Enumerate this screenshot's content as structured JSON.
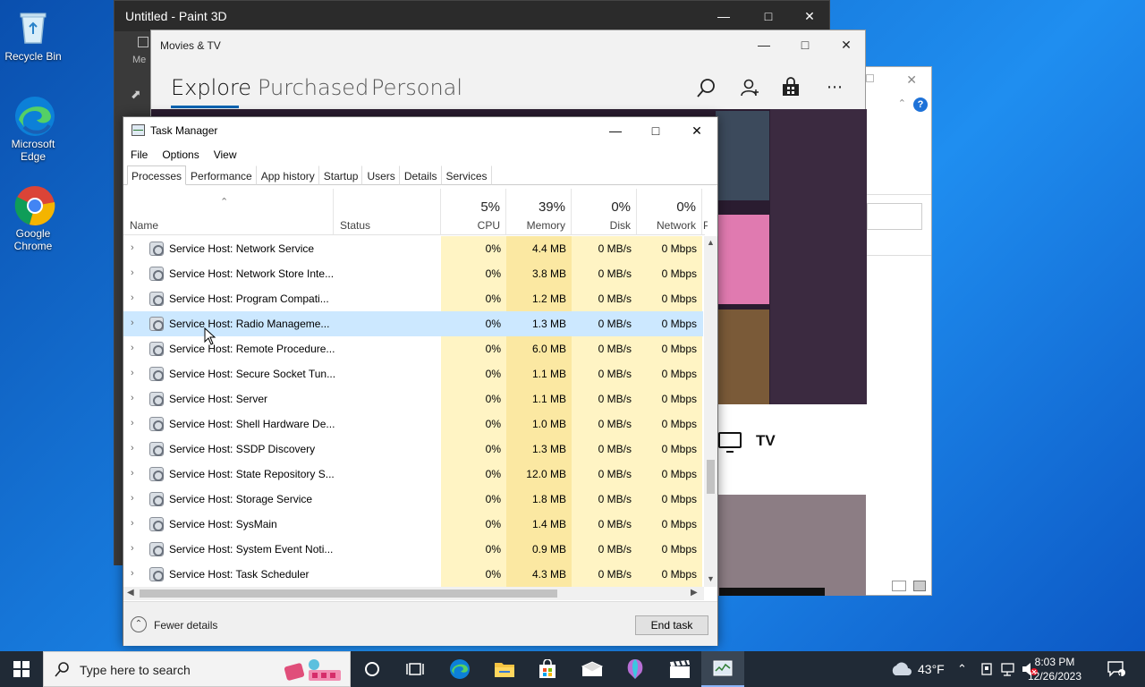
{
  "desktop": {
    "icons": [
      {
        "label": "Recycle Bin"
      },
      {
        "label": "Microsoft Edge"
      },
      {
        "label": "Google Chrome"
      }
    ]
  },
  "paint3d": {
    "title": "Untitled - Paint 3D",
    "menu_fragment": "Me"
  },
  "movies": {
    "title": "Movies & TV",
    "tabs": [
      "Explore",
      "Purchased",
      "Personal"
    ],
    "active_tab": "Explore",
    "tv_label": "TV"
  },
  "task_manager": {
    "title": "Task Manager",
    "menu": [
      "File",
      "Options",
      "View"
    ],
    "tabs": [
      "Processes",
      "Performance",
      "App history",
      "Startup",
      "Users",
      "Details",
      "Services"
    ],
    "active_tab": "Processes",
    "columns": {
      "name": "Name",
      "status": "Status",
      "cpu": {
        "label": "CPU",
        "pct": "5%"
      },
      "memory": {
        "label": "Memory",
        "pct": "39%"
      },
      "disk": {
        "label": "Disk",
        "pct": "0%"
      },
      "network": {
        "label": "Network",
        "pct": "0%"
      },
      "power_fragment": "P"
    },
    "rows": [
      {
        "name": "Service Host: Network Service",
        "cpu": "0%",
        "memory": "4.4 MB",
        "disk": "0 MB/s",
        "network": "0 Mbps"
      },
      {
        "name": "Service Host: Network Store Inte...",
        "cpu": "0%",
        "memory": "3.8 MB",
        "disk": "0 MB/s",
        "network": "0 Mbps"
      },
      {
        "name": "Service Host: Program Compati...",
        "cpu": "0%",
        "memory": "1.2 MB",
        "disk": "0 MB/s",
        "network": "0 Mbps"
      },
      {
        "name": "Service Host: Radio Manageme...",
        "cpu": "0%",
        "memory": "1.3 MB",
        "disk": "0 MB/s",
        "network": "0 Mbps",
        "selected": true
      },
      {
        "name": "Service Host: Remote Procedure...",
        "cpu": "0%",
        "memory": "6.0 MB",
        "disk": "0 MB/s",
        "network": "0 Mbps"
      },
      {
        "name": "Service Host: Secure Socket Tun...",
        "cpu": "0%",
        "memory": "1.1 MB",
        "disk": "0 MB/s",
        "network": "0 Mbps"
      },
      {
        "name": "Service Host: Server",
        "cpu": "0%",
        "memory": "1.1 MB",
        "disk": "0 MB/s",
        "network": "0 Mbps"
      },
      {
        "name": "Service Host: Shell Hardware De...",
        "cpu": "0%",
        "memory": "1.0 MB",
        "disk": "0 MB/s",
        "network": "0 Mbps"
      },
      {
        "name": "Service Host: SSDP Discovery",
        "cpu": "0%",
        "memory": "1.3 MB",
        "disk": "0 MB/s",
        "network": "0 Mbps"
      },
      {
        "name": "Service Host: State Repository S...",
        "cpu": "0%",
        "memory": "12.0 MB",
        "disk": "0 MB/s",
        "network": "0 Mbps"
      },
      {
        "name": "Service Host: Storage Service",
        "cpu": "0%",
        "memory": "1.8 MB",
        "disk": "0 MB/s",
        "network": "0 Mbps"
      },
      {
        "name": "Service Host: SysMain",
        "cpu": "0%",
        "memory": "1.4 MB",
        "disk": "0 MB/s",
        "network": "0 Mbps"
      },
      {
        "name": "Service Host: System Event Noti...",
        "cpu": "0%",
        "memory": "0.9 MB",
        "disk": "0 MB/s",
        "network": "0 Mbps"
      },
      {
        "name": "Service Host: Task Scheduler",
        "cpu": "0%",
        "memory": "4.3 MB",
        "disk": "0 MB/s",
        "network": "0 Mbps"
      }
    ],
    "footer": {
      "fewer_details": "Fewer details",
      "end_task": "End task"
    }
  },
  "taskbar": {
    "search_placeholder": "Type here to search",
    "weather": "43°F",
    "time": "8:03 PM",
    "date": "12/26/2023"
  },
  "colors": {
    "cpu_bg": "#fff4c4",
    "memory_bg": "#fbe8a2",
    "selected_row": "#cce8ff",
    "accent": "#0063b1"
  }
}
